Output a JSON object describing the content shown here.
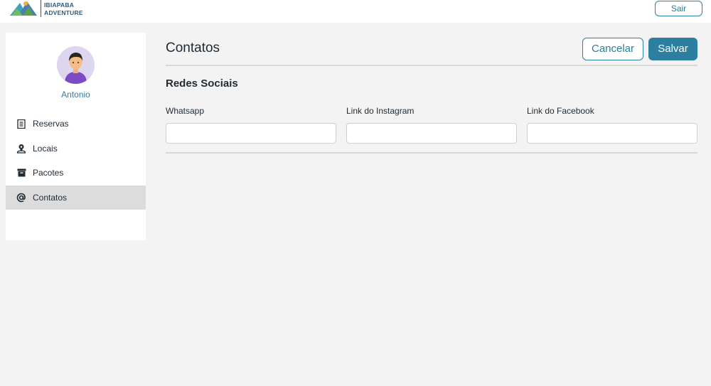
{
  "header": {
    "brand_line1": "IBIAPABA",
    "brand_line2": "ADVENTURE",
    "logout_label": "Sair"
  },
  "sidebar": {
    "user_name": "Antonio",
    "items": [
      {
        "label": "Reservas",
        "icon": "receipt-icon"
      },
      {
        "label": "Locais",
        "icon": "location-person-icon"
      },
      {
        "label": "Pacotes",
        "icon": "archive-box-icon"
      },
      {
        "label": "Contatos",
        "icon": "at-sign-icon",
        "active": true
      }
    ]
  },
  "main": {
    "title": "Contatos",
    "cancel_label": "Cancelar",
    "save_label": "Salvar",
    "section_title": "Redes Sociais",
    "fields": [
      {
        "label": "Whatsapp",
        "value": ""
      },
      {
        "label": "Link do Instagram",
        "value": ""
      },
      {
        "label": "Link do Facebook",
        "value": ""
      }
    ]
  },
  "colors": {
    "accent": "#2d7fa0",
    "background": "#f3f3f3",
    "active_nav": "#dcdcdc"
  }
}
